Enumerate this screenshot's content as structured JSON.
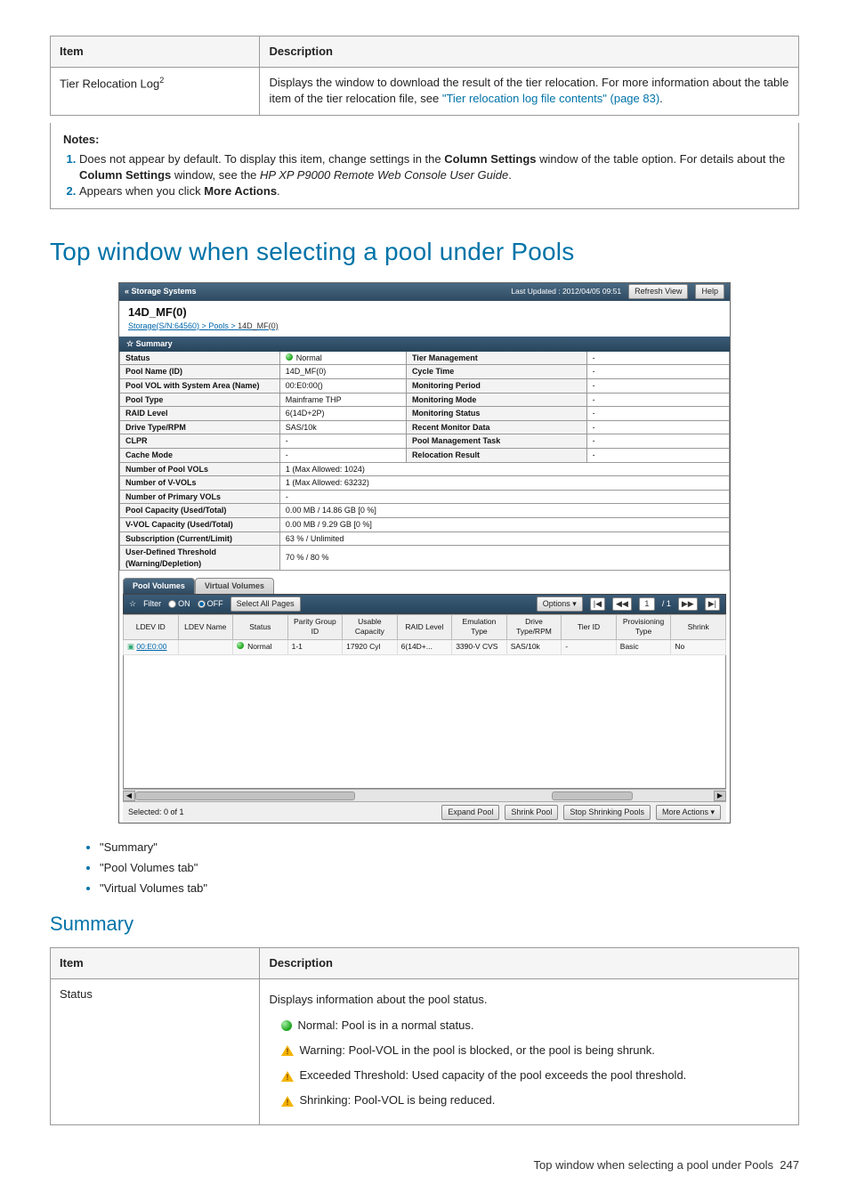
{
  "table1": {
    "h1": "Item",
    "h2": "Description",
    "row_item": "Tier Relocation Log",
    "row_item_sup": "2",
    "row_desc_a": "Displays the window to download the result of the tier relocation. For more information about the table item of the tier relocation file, see ",
    "row_desc_link": "\"Tier relocation log file contents\" (page 83)",
    "row_desc_b": "."
  },
  "notes": {
    "head": "Notes:",
    "n1a": "Does not appear by default. To display this item, change settings in the ",
    "n1b": "Column Settings",
    "n1c": " window of the table option. For details about the ",
    "n1d": "Column Settings",
    "n1e": " window, see the ",
    "n1f": "HP XP P9000 Remote Web Console User Guide",
    "n1g": ".",
    "n2a": "Appears when you click ",
    "n2b": "More Actions",
    "n2c": "."
  },
  "heading": "Top window when selecting a pool under Pools",
  "app": {
    "storage_systems": "« Storage Systems",
    "last_updated": "Last Updated : 2012/04/05 09:51",
    "refresh": "Refresh View",
    "help": "Help",
    "title": "14D_MF(0)",
    "path_a": "Storage(S/N:64560)",
    "path_b": "Pools",
    "path_c": "14D_MF(0)",
    "summary_bar_icon": "☆",
    "summary_bar": "Summary"
  },
  "summary_left": [
    {
      "k": "Status",
      "v": "Normal",
      "dot": true
    },
    {
      "k": "Pool Name (ID)",
      "v": "14D_MF(0)"
    },
    {
      "k": "Pool VOL with System Area (Name)",
      "v": "00:E0:00()"
    },
    {
      "k": "Pool Type",
      "v": "Mainframe THP"
    },
    {
      "k": "RAID Level",
      "v": "6(14D+2P)"
    },
    {
      "k": "Drive Type/RPM",
      "v": "SAS/10k"
    },
    {
      "k": "CLPR",
      "v": "-"
    },
    {
      "k": "Cache Mode",
      "v": "-"
    }
  ],
  "summary_right": [
    {
      "k": "Tier Management",
      "v": "-"
    },
    {
      "k": "Cycle Time",
      "v": "-"
    },
    {
      "k": "Monitoring Period",
      "v": "-"
    },
    {
      "k": "Monitoring Mode",
      "v": "-"
    },
    {
      "k": "Monitoring Status",
      "v": "-"
    },
    {
      "k": "Recent Monitor Data",
      "v": "-"
    },
    {
      "k": "Pool Management Task",
      "v": "-"
    },
    {
      "k": "Relocation Result",
      "v": "-"
    }
  ],
  "summary_wide": [
    {
      "k": "Number of Pool VOLs",
      "v": "1 (Max Allowed: 1024)"
    },
    {
      "k": "Number of V-VOLs",
      "v": "1 (Max Allowed: 63232)"
    },
    {
      "k": "Number of Primary VOLs",
      "v": "-"
    },
    {
      "k": "Pool Capacity (Used/Total)",
      "v": "0.00 MB / 14.86 GB [0 %]"
    },
    {
      "k": "V-VOL Capacity (Used/Total)",
      "v": "0.00 MB / 9.29 GB [0 %]"
    },
    {
      "k": "Subscription (Current/Limit)",
      "v": "63 % / Unlimited"
    },
    {
      "k": "User-Defined Threshold (Warning/Depletion)",
      "v": "70 % / 80 %"
    }
  ],
  "tabs": {
    "a": "Pool Volumes",
    "b": "Virtual Volumes"
  },
  "toolbar": {
    "filter_icon": "☆",
    "filter": "Filter",
    "on": "ON",
    "off": "OFF",
    "select_all": "Select All Pages",
    "options": "Options",
    "first": "|◀",
    "prev": "◀◀",
    "page": "1",
    "pages": "/ 1",
    "next": "▶▶",
    "last": "▶|"
  },
  "grid": {
    "cols": [
      "LDEV ID",
      "LDEV Name",
      "Status",
      "Parity Group ID",
      "Usable Capacity",
      "RAID Level",
      "Emulation Type",
      "Drive Type/RPM",
      "Tier ID",
      "Provisioning Type",
      "Shrink"
    ],
    "row": {
      "ldev": "00:E0:00",
      "name": "",
      "status": "Normal",
      "pg": "1-1",
      "cap": "17920 Cyl",
      "raid": "6(14D+...",
      "emu": "3390-V CVS",
      "drive": "SAS/10k",
      "tier": "-",
      "prov": "Basic",
      "shrink": "No"
    }
  },
  "footer": {
    "selected": "Selected: 0 of 1",
    "b1": "Expand Pool",
    "b2": "Shrink Pool",
    "b3": "Stop Shrinking Pools",
    "b4": "More Actions ▾"
  },
  "bullets": {
    "a": "\"Summary\"",
    "b": "\"Pool Volumes tab\"",
    "c": "\"Virtual Volumes tab\""
  },
  "sub_heading": "Summary",
  "table2": {
    "h1": "Item",
    "h2": "Description",
    "item": "Status",
    "d0": "Displays information about the pool status.",
    "d1": "Normal: Pool is in a normal status.",
    "d2": "Warning: Pool-VOL in the pool is blocked, or the pool is being shrunk.",
    "d3": "Exceeded Threshold: Used capacity of the pool exceeds the pool threshold.",
    "d4": "Shrinking: Pool-VOL is being reduced."
  },
  "page_footer": {
    "text": "Top window when selecting a pool under Pools",
    "num": "247"
  }
}
